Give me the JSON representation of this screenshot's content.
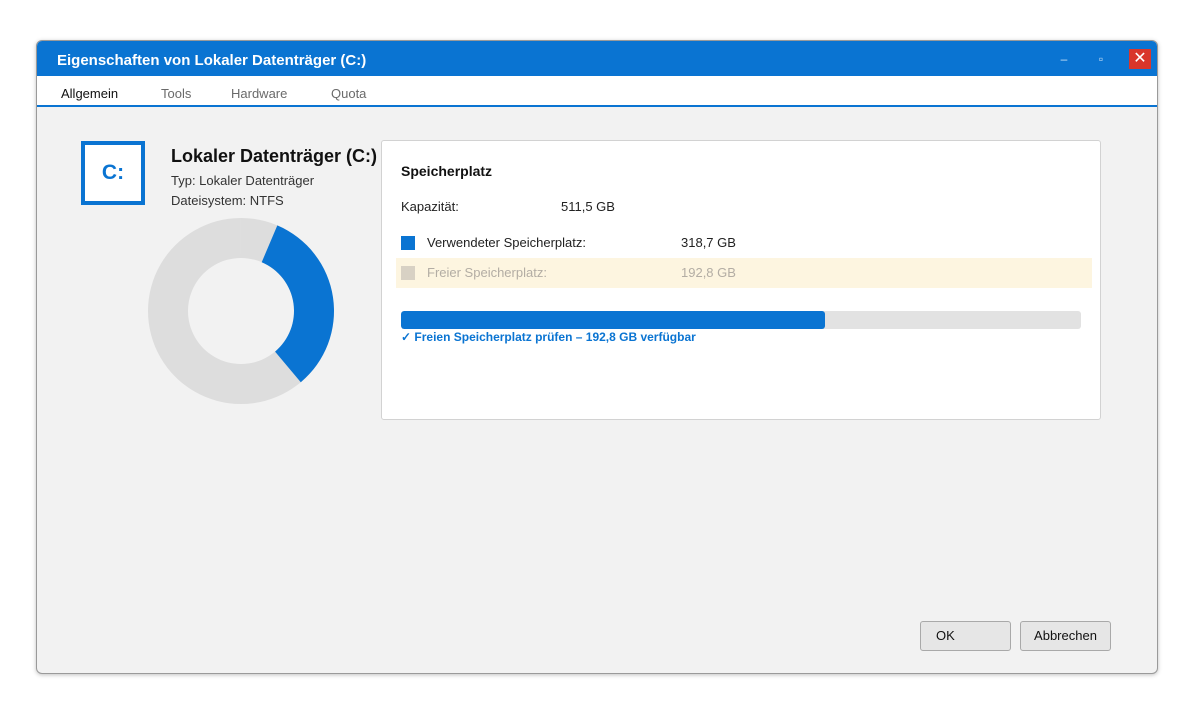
{
  "window": {
    "title": "Eigenschaften von Lokaler Datenträger (C:)",
    "controls": {
      "minimize": "–",
      "maximize": "▫",
      "close": "✕"
    }
  },
  "tabs": [
    {
      "label": "Allgemein",
      "active": true
    },
    {
      "label": "Tools",
      "active": false
    },
    {
      "label": "Hardware",
      "active": false
    },
    {
      "label": "Quota",
      "active": false
    }
  ],
  "drive": {
    "icon_letter": "C:",
    "name": "Lokaler Datenträger (C:)",
    "type": "Typ: Lokaler Datenträger",
    "filesystem": "Dateisystem: NTFS"
  },
  "storage": {
    "title": "Speicherplatz",
    "capacity_label": "Kapazität:",
    "capacity_value": "511,5 GB",
    "used_label": "Verwendeter Speicherplatz:",
    "used_value": "318,7 GB",
    "free_label": "Freier Speicherplatz:",
    "free_value": "192,8 GB",
    "used_fraction": 0.623,
    "check_link": "✓ Freien Speicherplatz prüfen – 192,8 GB verfügbar"
  },
  "buttons": {
    "ok": "OK",
    "cancel": "Abbrechen"
  },
  "colors": {
    "accent": "#0a74d2",
    "free": "#dddddd",
    "close": "#d9362b",
    "free_row_bg": "#fdf5e0"
  }
}
